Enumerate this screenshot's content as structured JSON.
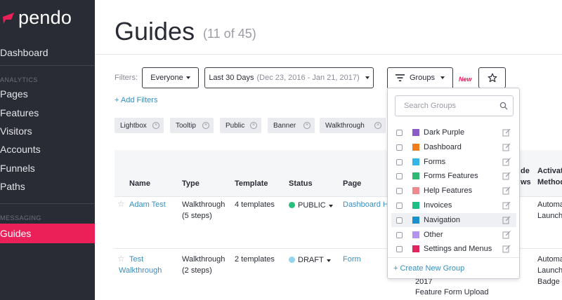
{
  "brand": {
    "name": "pendo",
    "color": "#ec2059"
  },
  "sidebar": {
    "items": [
      {
        "label": "Dashboard"
      },
      {
        "label": "ANALYTICS"
      },
      {
        "label": "Pages"
      },
      {
        "label": "Features"
      },
      {
        "label": "Visitors"
      },
      {
        "label": "Accounts"
      },
      {
        "label": "Funnels"
      },
      {
        "label": "Paths"
      },
      {
        "label": "MESSAGING"
      },
      {
        "label": "Guides",
        "active": true
      }
    ]
  },
  "header": {
    "title": "Guides",
    "count": "(11 of 45)"
  },
  "filters": {
    "label": "Filters:",
    "segment": "Everyone",
    "date_range": "Last 30 Days",
    "date_detail": "(Dec 23, 2016 - Jan 21, 2017)",
    "groups": "Groups",
    "new_badge": "New",
    "add_filters": "+ Add Filters",
    "chips": [
      "Lightbox",
      "Tooltip",
      "Public",
      "Banner",
      "Walkthrough"
    ]
  },
  "table": {
    "columns": [
      "Name",
      "Type",
      "Template",
      "Status",
      "Page"
    ],
    "partial_columns": {
      "views_a": "de",
      "views_b": "ws",
      "activation_a": "Activat",
      "activation_b": "Method"
    },
    "rows": [
      {
        "name": "Adam Test",
        "type_a": "Walkthrough",
        "type_b": "(5 steps)",
        "template": "4 templates",
        "status": "PUBLIC",
        "status_color": "#27c07a",
        "page": "Dashboard H",
        "activation_a": "Automa",
        "activation_b": "Launch"
      },
      {
        "name_a": "Test",
        "name_b": "Walkthrough",
        "type_a": "Walkthrough",
        "type_b": "(2 steps)",
        "template": "2 templates",
        "status": "DRAFT",
        "status_color": "#8fd6ee",
        "page": "Form",
        "views_a": "2017",
        "views_b": "Feature Form Upload",
        "activation_a": "Automa",
        "activation_b": "Launch",
        "activation_c": "Badge"
      }
    ]
  },
  "groups_dropdown": {
    "search_placeholder": "Search Groups",
    "items": [
      {
        "label": "Dark Purple",
        "color": "#8a5cc7"
      },
      {
        "label": "Dashboard",
        "color": "#f07e1f"
      },
      {
        "label": "Forms",
        "color": "#33b6e6"
      },
      {
        "label": "Forms Features",
        "color": "#2fb774"
      },
      {
        "label": "Help Features",
        "color": "#f08a8e"
      },
      {
        "label": "Invoices",
        "color": "#1ebf85"
      },
      {
        "label": "Navigation",
        "color": "#1a8fc9"
      },
      {
        "label": "Other",
        "color": "#b294ee"
      },
      {
        "label": "Settings and Menus",
        "color": "#e0245e"
      }
    ],
    "create_label": "+ Create New Group"
  }
}
